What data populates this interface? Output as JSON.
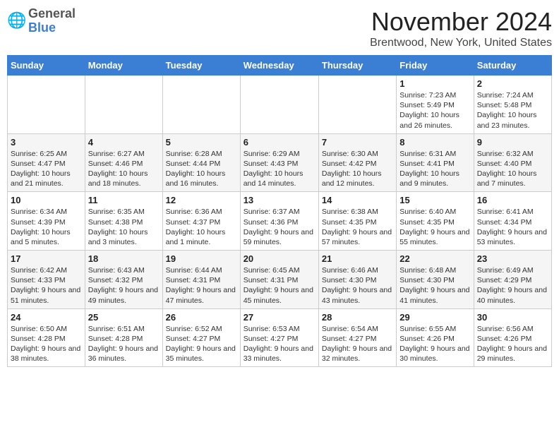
{
  "header": {
    "logo_general": "General",
    "logo_blue": "Blue",
    "month_title": "November 2024",
    "location": "Brentwood, New York, United States"
  },
  "weekdays": [
    "Sunday",
    "Monday",
    "Tuesday",
    "Wednesday",
    "Thursday",
    "Friday",
    "Saturday"
  ],
  "weeks": [
    [
      {
        "day": "",
        "info": ""
      },
      {
        "day": "",
        "info": ""
      },
      {
        "day": "",
        "info": ""
      },
      {
        "day": "",
        "info": ""
      },
      {
        "day": "",
        "info": ""
      },
      {
        "day": "1",
        "info": "Sunrise: 7:23 AM\nSunset: 5:49 PM\nDaylight: 10 hours and 26 minutes."
      },
      {
        "day": "2",
        "info": "Sunrise: 7:24 AM\nSunset: 5:48 PM\nDaylight: 10 hours and 23 minutes."
      }
    ],
    [
      {
        "day": "3",
        "info": "Sunrise: 6:25 AM\nSunset: 4:47 PM\nDaylight: 10 hours and 21 minutes."
      },
      {
        "day": "4",
        "info": "Sunrise: 6:27 AM\nSunset: 4:46 PM\nDaylight: 10 hours and 18 minutes."
      },
      {
        "day": "5",
        "info": "Sunrise: 6:28 AM\nSunset: 4:44 PM\nDaylight: 10 hours and 16 minutes."
      },
      {
        "day": "6",
        "info": "Sunrise: 6:29 AM\nSunset: 4:43 PM\nDaylight: 10 hours and 14 minutes."
      },
      {
        "day": "7",
        "info": "Sunrise: 6:30 AM\nSunset: 4:42 PM\nDaylight: 10 hours and 12 minutes."
      },
      {
        "day": "8",
        "info": "Sunrise: 6:31 AM\nSunset: 4:41 PM\nDaylight: 10 hours and 9 minutes."
      },
      {
        "day": "9",
        "info": "Sunrise: 6:32 AM\nSunset: 4:40 PM\nDaylight: 10 hours and 7 minutes."
      }
    ],
    [
      {
        "day": "10",
        "info": "Sunrise: 6:34 AM\nSunset: 4:39 PM\nDaylight: 10 hours and 5 minutes."
      },
      {
        "day": "11",
        "info": "Sunrise: 6:35 AM\nSunset: 4:38 PM\nDaylight: 10 hours and 3 minutes."
      },
      {
        "day": "12",
        "info": "Sunrise: 6:36 AM\nSunset: 4:37 PM\nDaylight: 10 hours and 1 minute."
      },
      {
        "day": "13",
        "info": "Sunrise: 6:37 AM\nSunset: 4:36 PM\nDaylight: 9 hours and 59 minutes."
      },
      {
        "day": "14",
        "info": "Sunrise: 6:38 AM\nSunset: 4:35 PM\nDaylight: 9 hours and 57 minutes."
      },
      {
        "day": "15",
        "info": "Sunrise: 6:40 AM\nSunset: 4:35 PM\nDaylight: 9 hours and 55 minutes."
      },
      {
        "day": "16",
        "info": "Sunrise: 6:41 AM\nSunset: 4:34 PM\nDaylight: 9 hours and 53 minutes."
      }
    ],
    [
      {
        "day": "17",
        "info": "Sunrise: 6:42 AM\nSunset: 4:33 PM\nDaylight: 9 hours and 51 minutes."
      },
      {
        "day": "18",
        "info": "Sunrise: 6:43 AM\nSunset: 4:32 PM\nDaylight: 9 hours and 49 minutes."
      },
      {
        "day": "19",
        "info": "Sunrise: 6:44 AM\nSunset: 4:31 PM\nDaylight: 9 hours and 47 minutes."
      },
      {
        "day": "20",
        "info": "Sunrise: 6:45 AM\nSunset: 4:31 PM\nDaylight: 9 hours and 45 minutes."
      },
      {
        "day": "21",
        "info": "Sunrise: 6:46 AM\nSunset: 4:30 PM\nDaylight: 9 hours and 43 minutes."
      },
      {
        "day": "22",
        "info": "Sunrise: 6:48 AM\nSunset: 4:30 PM\nDaylight: 9 hours and 41 minutes."
      },
      {
        "day": "23",
        "info": "Sunrise: 6:49 AM\nSunset: 4:29 PM\nDaylight: 9 hours and 40 minutes."
      }
    ],
    [
      {
        "day": "24",
        "info": "Sunrise: 6:50 AM\nSunset: 4:28 PM\nDaylight: 9 hours and 38 minutes."
      },
      {
        "day": "25",
        "info": "Sunrise: 6:51 AM\nSunset: 4:28 PM\nDaylight: 9 hours and 36 minutes."
      },
      {
        "day": "26",
        "info": "Sunrise: 6:52 AM\nSunset: 4:27 PM\nDaylight: 9 hours and 35 minutes."
      },
      {
        "day": "27",
        "info": "Sunrise: 6:53 AM\nSunset: 4:27 PM\nDaylight: 9 hours and 33 minutes."
      },
      {
        "day": "28",
        "info": "Sunrise: 6:54 AM\nSunset: 4:27 PM\nDaylight: 9 hours and 32 minutes."
      },
      {
        "day": "29",
        "info": "Sunrise: 6:55 AM\nSunset: 4:26 PM\nDaylight: 9 hours and 30 minutes."
      },
      {
        "day": "30",
        "info": "Sunrise: 6:56 AM\nSunset: 4:26 PM\nDaylight: 9 hours and 29 minutes."
      }
    ]
  ]
}
